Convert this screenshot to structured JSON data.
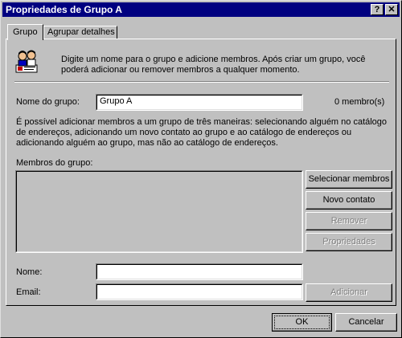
{
  "window": {
    "title": "Propriedades de Grupo A"
  },
  "titlebar": {
    "help_label": "?",
    "close_label": "✕"
  },
  "tabs": [
    {
      "label": "Grupo"
    },
    {
      "label": "Agrupar detalhes"
    }
  ],
  "intro": {
    "icon": "group-people-icon",
    "text": "Digite um nome para o grupo e adicione membros. Após criar um grupo, você poderá adicionar ou remover membros a qualquer momento."
  },
  "group_name": {
    "label": "Nome do grupo:",
    "value": "Grupo A",
    "member_count": "0 membro(s)"
  },
  "description": "É possível adicionar membros a um grupo de três maneiras: selecionando alguém no catálogo de endereços, adicionando um novo contato ao grupo e ao catálogo de endereços ou adicionando alguém ao grupo, mas não ao catálogo de endereços.",
  "members": {
    "label": "Membros do grupo:"
  },
  "buttons": {
    "select_members": "Selecionar membros",
    "new_contact": "Novo contato",
    "remove": "Remover",
    "properties": "Propriedades",
    "add": "Adicionar",
    "ok": "OK",
    "cancel": "Cancelar"
  },
  "fields": {
    "name_label": "Nome:",
    "name_value": "",
    "email_label": "Email:",
    "email_value": ""
  },
  "colors": {
    "titlebar": "#000080",
    "face": "#c0c0c0",
    "disabled_text": "#808080"
  }
}
